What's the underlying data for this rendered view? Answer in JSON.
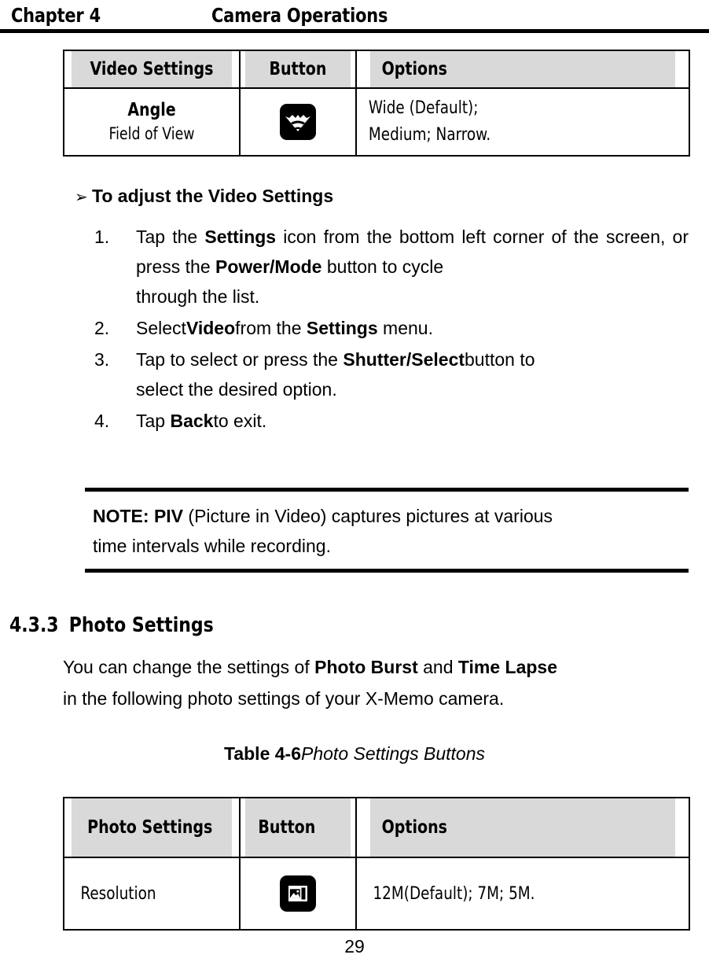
{
  "header": {
    "chapter": "Chapter 4",
    "title": "Camera Operations"
  },
  "video_table": {
    "columns": [
      "Video Settings",
      "Button",
      "Options"
    ],
    "rows": [
      {
        "setting": "Angle",
        "setting_sub": "Field of View",
        "button_icon": "wide-angle-icon",
        "options_line1": "Wide (Default);",
        "options_line2": "Medium; Narrow."
      }
    ]
  },
  "procedure": {
    "heading_bullet": "➢",
    "heading": "To adjust the Video Settings",
    "steps": [
      {
        "number": "1.",
        "parts": [
          {
            "text": "Tap the ",
            "bold": false
          },
          {
            "text": "Settings",
            "bold": true
          },
          {
            "text": " icon from the bottom left corner of the screen, or press the ",
            "bold": false
          },
          {
            "text": "Power/Mode",
            "bold": true
          },
          {
            "text": " button to cycle ",
            "bold": false
          }
        ],
        "last_line": "through the list."
      },
      {
        "number": "2.",
        "parts": [
          {
            "text": "Select",
            "bold": false
          },
          {
            "text": "Video",
            "bold": true
          },
          {
            "text": "from the ",
            "bold": false
          },
          {
            "text": "Settings",
            "bold": true
          },
          {
            "text": " menu.",
            "bold": false
          }
        ],
        "last_line": ""
      },
      {
        "number": "3.",
        "parts": [
          {
            "text": "Tap to select or press the ",
            "bold": false
          },
          {
            "text": "Shutter/Select",
            "bold": true
          },
          {
            "text": "button to ",
            "bold": false
          }
        ],
        "last_line": "select the desired option."
      },
      {
        "number": "4.",
        "parts": [
          {
            "text": "Tap ",
            "bold": false
          },
          {
            "text": "Back",
            "bold": true
          },
          {
            "text": "to exit.",
            "bold": false
          }
        ],
        "last_line": ""
      }
    ]
  },
  "note": {
    "parts": [
      {
        "text": "NOTE: PIV",
        "bold": true
      },
      {
        "text": " (Picture in Video) captures pictures at various ",
        "bold": false
      }
    ],
    "last_line": "time intervals while recording."
  },
  "section": {
    "number": "4.3.3",
    "title": "Photo Settings",
    "paragraph_parts": [
      {
        "text": "You can change the settings of ",
        "bold": false
      },
      {
        "text": "Photo Burst",
        "bold": true
      },
      {
        "text": " and ",
        "bold": false
      },
      {
        "text": "Time Lapse",
        "bold": true
      }
    ],
    "paragraph_last_line": "in the following photo settings of your X-Memo camera."
  },
  "table_caption": {
    "number": "Table 4-6",
    "title": "Photo Settings Buttons"
  },
  "photo_table": {
    "columns": [
      "Photo Settings",
      "Button",
      "Options"
    ],
    "rows": [
      {
        "setting": "Resolution",
        "button_icon": "photo-resolution-icon",
        "options": "12M(Default); 7M; 5M."
      }
    ]
  },
  "page_number": "29",
  "colors": {
    "table_header_bg": "#d9d9d9",
    "rule": "#000000",
    "text": "#000000"
  }
}
